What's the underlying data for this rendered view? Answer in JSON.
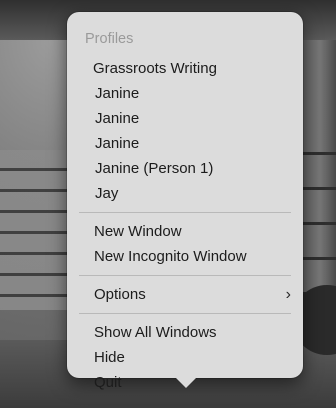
{
  "menu": {
    "profiles_header": "Profiles",
    "profiles": [
      "Grassroots Writing",
      "Janine",
      "Janine",
      "Janine",
      "Janine (Person 1)",
      "Jay"
    ],
    "window_items": [
      "New Window",
      "New Incognito Window"
    ],
    "options_label": "Options",
    "options_submenu_icon": "chevron-right-icon",
    "app_items": [
      "Show All Windows",
      "Hide",
      "Quit"
    ]
  }
}
